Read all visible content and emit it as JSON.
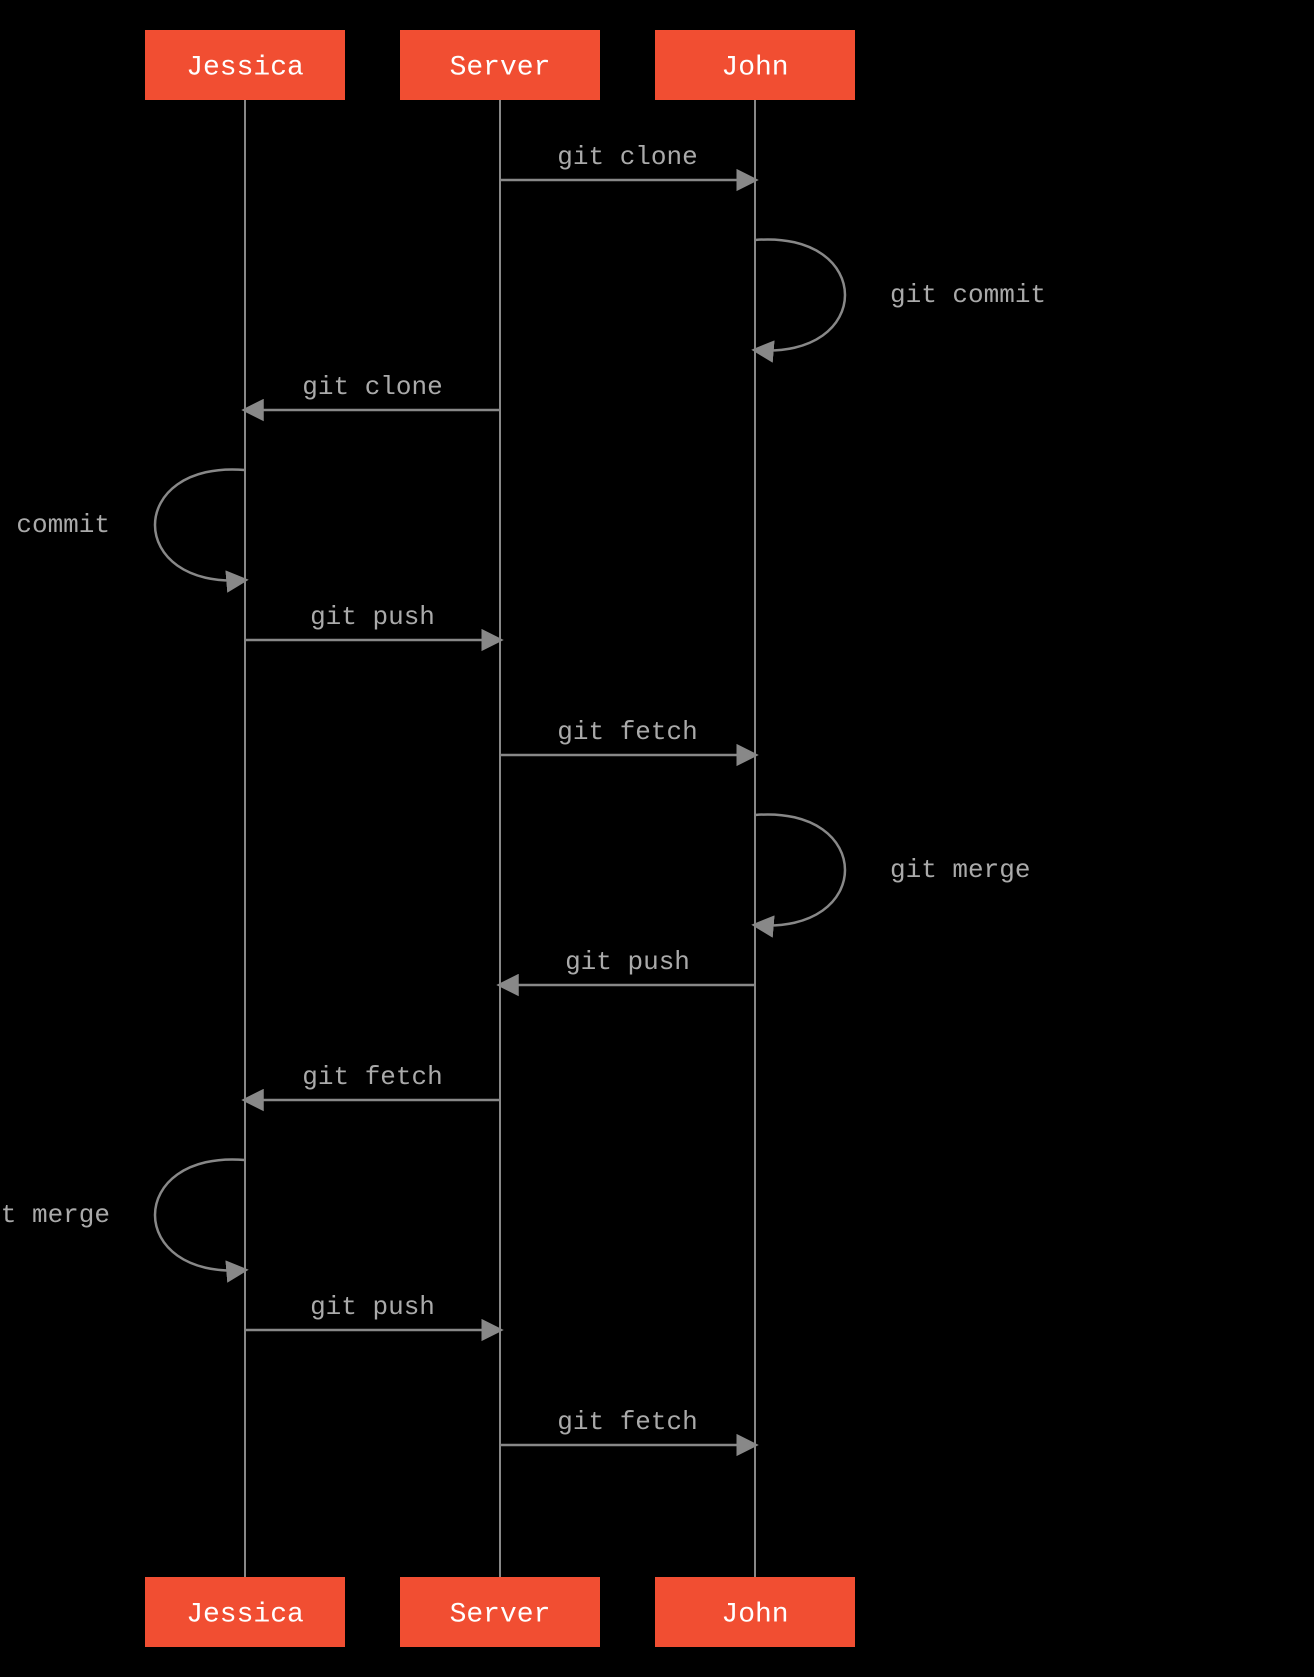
{
  "diagram": {
    "type": "sequence",
    "actors": [
      {
        "id": "jessica",
        "label": "Jessica"
      },
      {
        "id": "server",
        "label": "Server"
      },
      {
        "id": "john",
        "label": "John"
      }
    ],
    "messages": [
      {
        "from": "server",
        "to": "john",
        "label": "git clone",
        "kind": "call"
      },
      {
        "from": "john",
        "to": "john",
        "label": "git commit",
        "kind": "self"
      },
      {
        "from": "server",
        "to": "jessica",
        "label": "git clone",
        "kind": "call"
      },
      {
        "from": "jessica",
        "to": "jessica",
        "label": "git commit",
        "kind": "self"
      },
      {
        "from": "jessica",
        "to": "server",
        "label": "git push",
        "kind": "call"
      },
      {
        "from": "server",
        "to": "john",
        "label": "git fetch",
        "kind": "call"
      },
      {
        "from": "john",
        "to": "john",
        "label": "git merge",
        "kind": "self"
      },
      {
        "from": "john",
        "to": "server",
        "label": "git push",
        "kind": "call"
      },
      {
        "from": "server",
        "to": "jessica",
        "label": "git fetch",
        "kind": "call"
      },
      {
        "from": "jessica",
        "to": "jessica",
        "label": "git merge",
        "kind": "self"
      },
      {
        "from": "jessica",
        "to": "server",
        "label": "git push",
        "kind": "call"
      },
      {
        "from": "server",
        "to": "john",
        "label": "git fetch",
        "kind": "call"
      }
    ],
    "colors": {
      "actor_fill": "#f14e32",
      "actor_text": "#ffffff",
      "line": "#888888",
      "label": "#aaaaaa",
      "background": "#000000"
    }
  }
}
